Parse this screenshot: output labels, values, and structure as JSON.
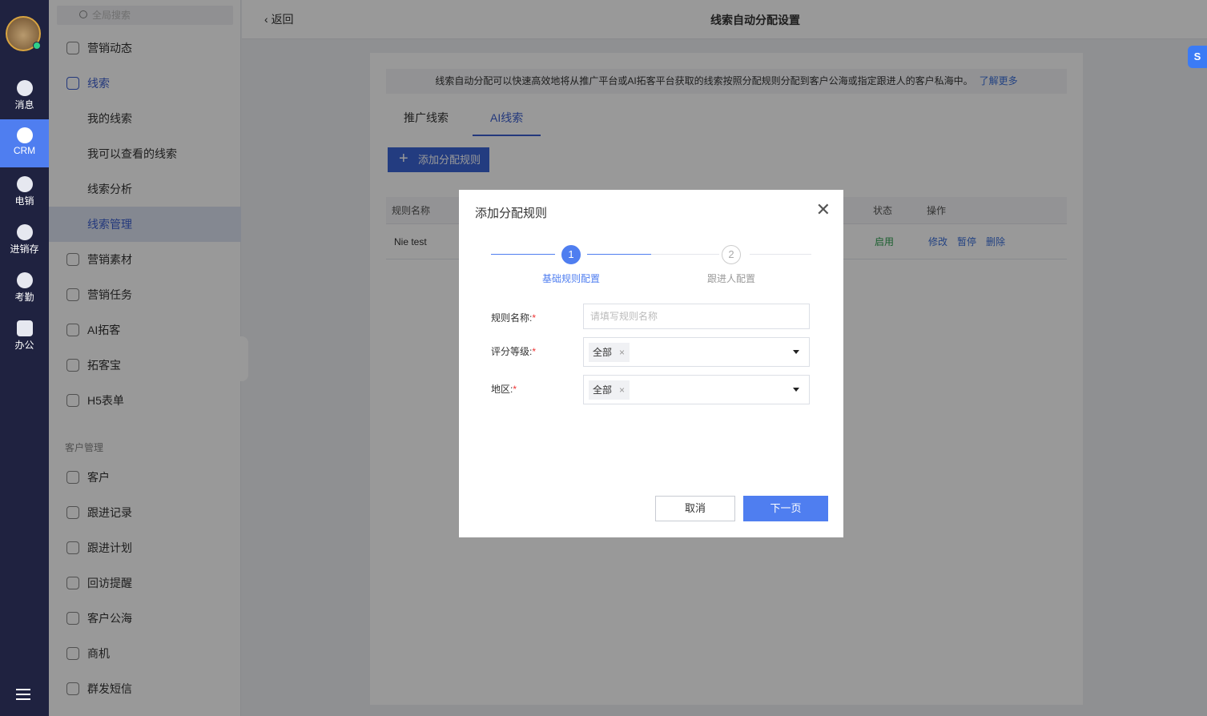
{
  "rail": {
    "items": [
      {
        "label": "消息"
      },
      {
        "label": "CRM"
      },
      {
        "label": "电销"
      },
      {
        "label": "进销存"
      },
      {
        "label": "考勤"
      },
      {
        "label": "办公"
      }
    ]
  },
  "sidebar": {
    "search_placeholder": "全局搜索",
    "items": [
      {
        "label": "营销动态"
      },
      {
        "label": "线索"
      },
      {
        "label": "我的线索"
      },
      {
        "label": "我可以查看的线索"
      },
      {
        "label": "线索分析"
      },
      {
        "label": "线索管理"
      },
      {
        "label": "营销素材"
      },
      {
        "label": "营销任务"
      },
      {
        "label": "AI拓客"
      },
      {
        "label": "拓客宝"
      },
      {
        "label": "H5表单"
      }
    ],
    "group": "客户管理",
    "group_items": [
      {
        "label": "客户"
      },
      {
        "label": "跟进记录"
      },
      {
        "label": "跟进计划"
      },
      {
        "label": "回访提醒"
      },
      {
        "label": "客户公海"
      },
      {
        "label": "商机"
      },
      {
        "label": "群发短信"
      }
    ]
  },
  "header": {
    "back": "返回",
    "title": "线索自动分配设置"
  },
  "main": {
    "notice": "线索自动分配可以快速高效地将从推广平台或AI拓客平台获取的线索按照分配规则分配到客户公海或指定跟进人的客户私海中。",
    "learn_more": "了解更多",
    "tabs": [
      {
        "label": "推广线索"
      },
      {
        "label": "AI线索"
      }
    ],
    "add_button": "添加分配规则",
    "columns": [
      "规则名称",
      "状态",
      "操作"
    ],
    "rows": [
      {
        "name": "Nie test",
        "status": "启用",
        "actions": [
          "修改",
          "暂停",
          "删除"
        ]
      }
    ]
  },
  "modal": {
    "title": "添加分配规则",
    "steps": [
      {
        "num": "1",
        "label": "基础规则配置"
      },
      {
        "num": "2",
        "label": "跟进人配置"
      }
    ],
    "fields": {
      "name_label": "规则名称:",
      "name_placeholder": "请填写规则名称",
      "grade_label": "评分等级:",
      "grade_value": "全部",
      "region_label": "地区:",
      "region_value": "全部",
      "required": "*",
      "remove": "×"
    },
    "cancel": "取消",
    "next": "下一页"
  },
  "colors": {
    "accent": "#4f7ef0",
    "rail": "#1f2240",
    "enabled": "#2e9e4f"
  }
}
